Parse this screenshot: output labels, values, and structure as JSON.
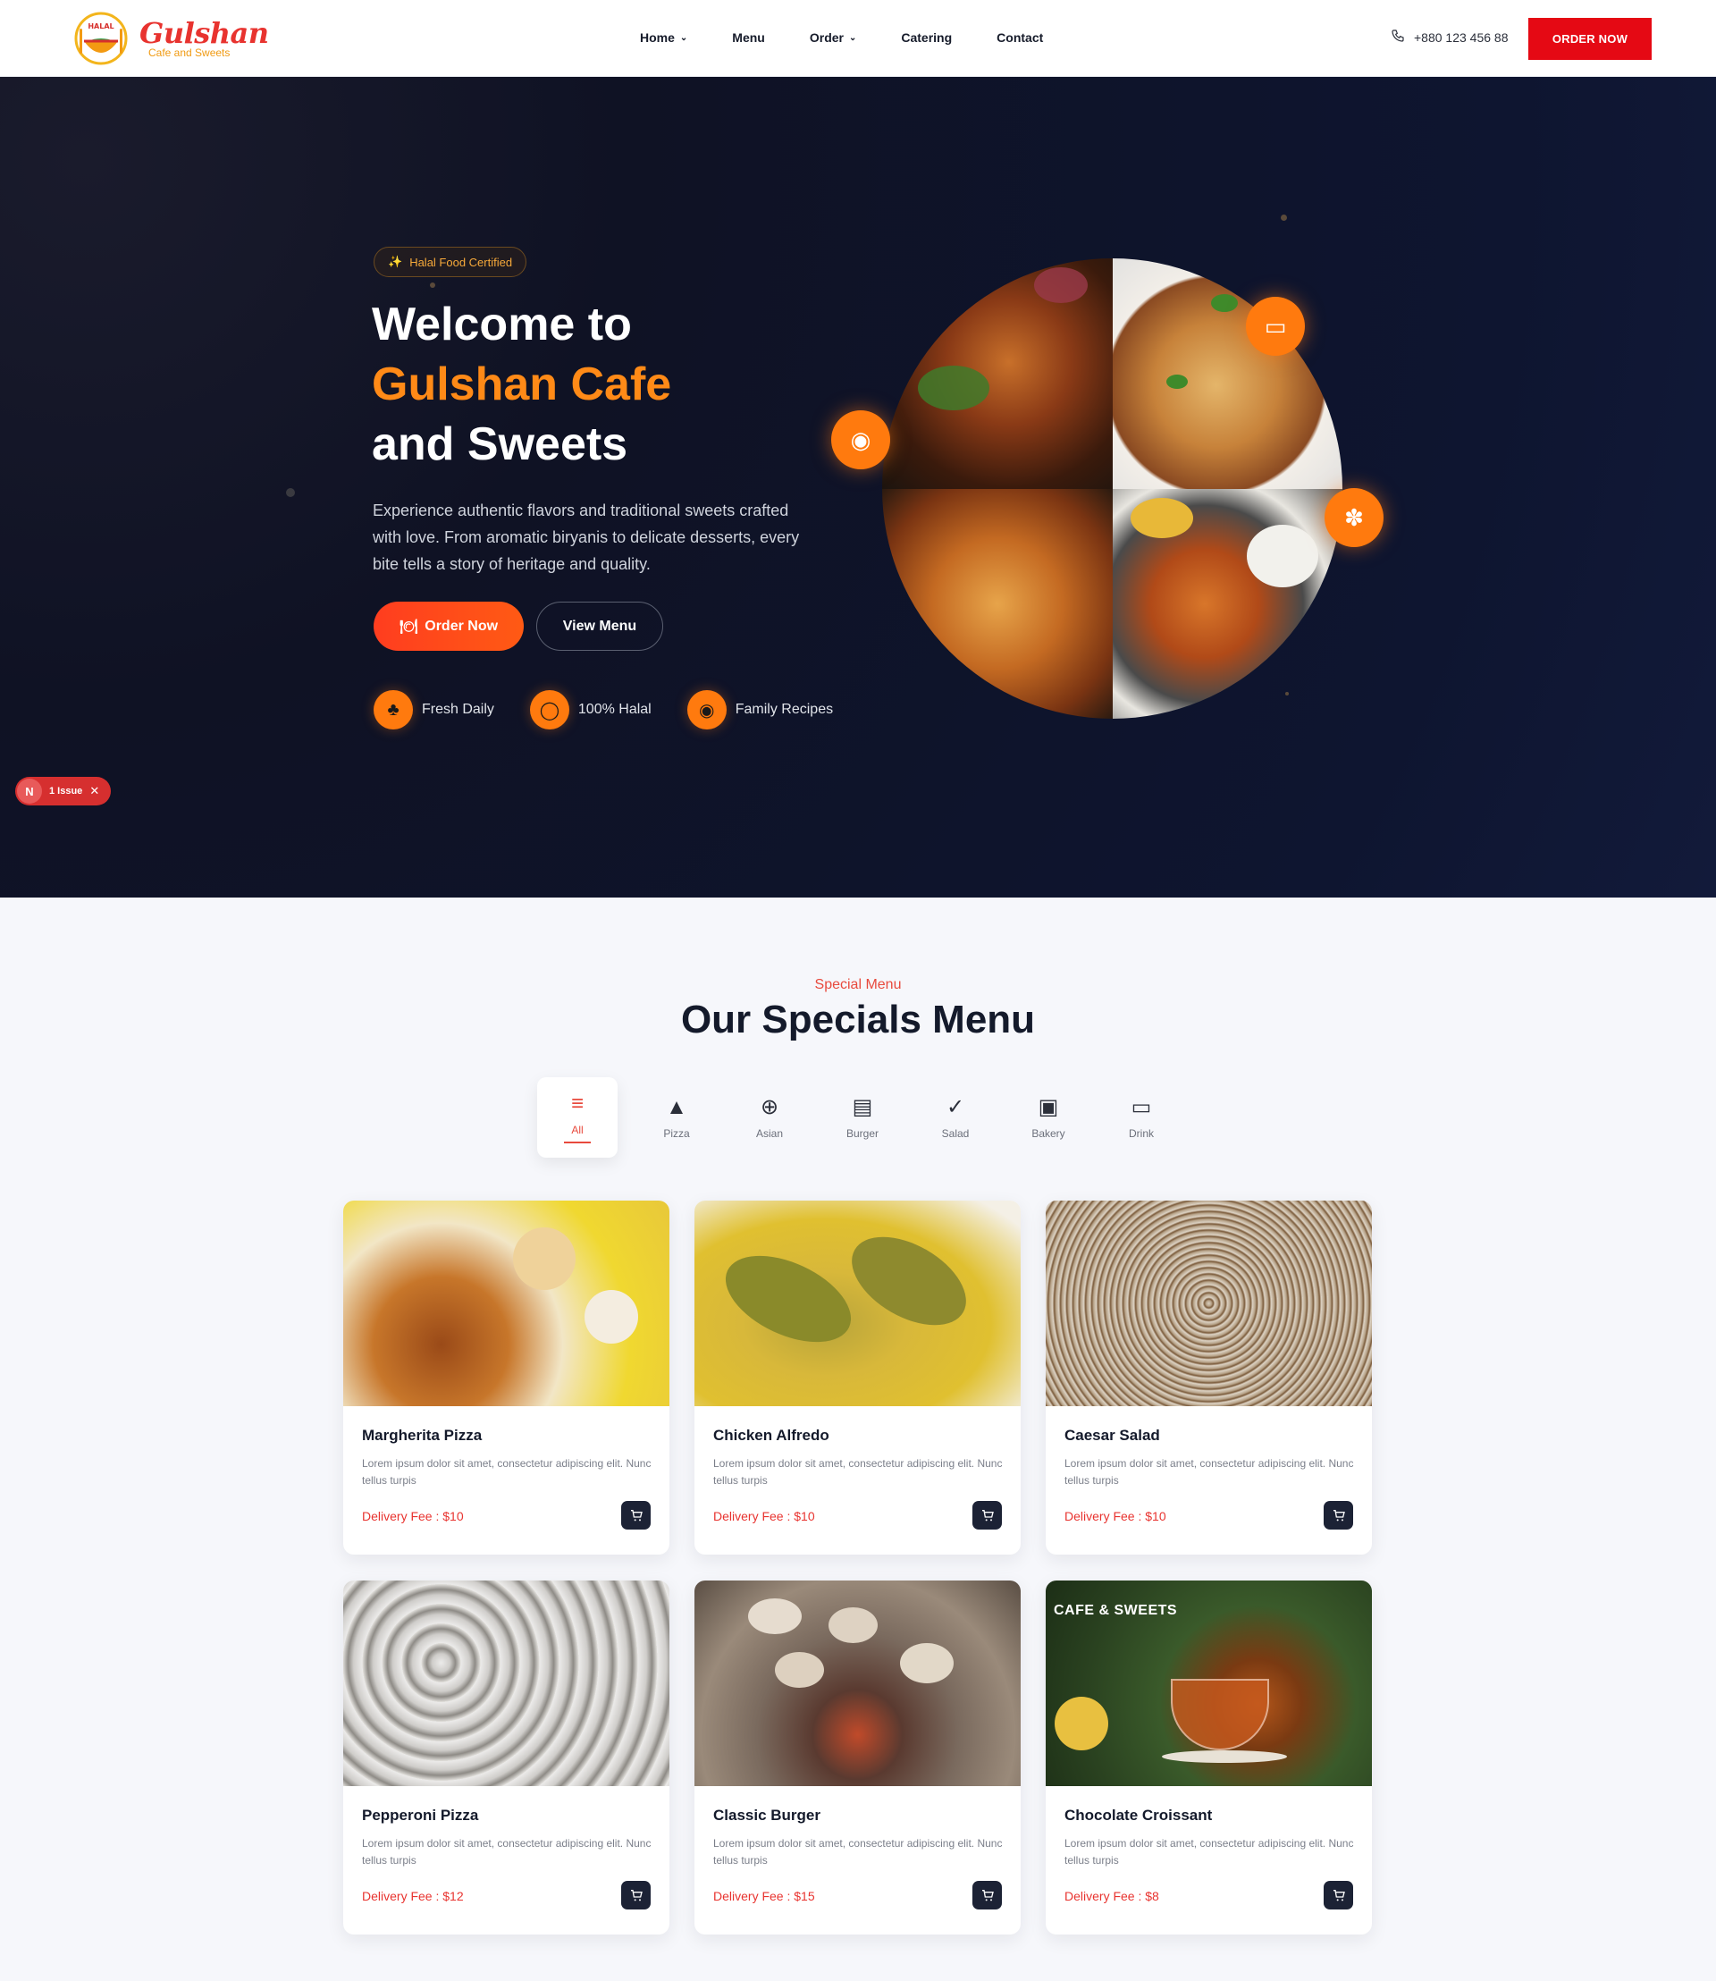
{
  "header": {
    "brand_name": "Gulshan",
    "brand_sub": "Cafe and Sweets",
    "halal_mark": "HALAL",
    "nav": [
      {
        "label": "Home",
        "has_dropdown": true
      },
      {
        "label": "Menu",
        "has_dropdown": false
      },
      {
        "label": "Order",
        "has_dropdown": true
      },
      {
        "label": "Catering",
        "has_dropdown": false
      },
      {
        "label": "Contact",
        "has_dropdown": false
      }
    ],
    "phone": "+880 123 456 88",
    "cta": "ORDER NOW"
  },
  "hero": {
    "badge": "Halal Food Certified",
    "title_line1": "Welcome to",
    "title_accent": "Gulshan Cafe",
    "title_line3": "and Sweets",
    "description": "Experience authentic flavors and traditional sweets crafted with love. From aromatic biryanis to delicate desserts, every bite tells a story of heritage and quality.",
    "primary_button": "Order Now",
    "secondary_button": "View Menu",
    "features": [
      {
        "label": "Fresh Daily",
        "icon": "clover-icon"
      },
      {
        "label": "100% Halal",
        "icon": "medal-icon"
      },
      {
        "label": "Family Recipes",
        "icon": "plate-icon"
      }
    ]
  },
  "issue_pill": {
    "letter": "N",
    "label": "1 Issue"
  },
  "specials": {
    "eyebrow": "Special Menu",
    "title": "Our Specials Menu",
    "categories": [
      {
        "label": "All",
        "icon": "list-icon",
        "active": true
      },
      {
        "label": "Pizza",
        "icon": "pizza-icon",
        "active": false
      },
      {
        "label": "Asian",
        "icon": "asian-icon",
        "active": false
      },
      {
        "label": "Burger",
        "icon": "burger-icon",
        "active": false
      },
      {
        "label": "Salad",
        "icon": "salad-icon",
        "active": false
      },
      {
        "label": "Bakery",
        "icon": "bakery-icon",
        "active": false
      },
      {
        "label": "Drink",
        "icon": "drink-icon",
        "active": false
      }
    ],
    "items": [
      {
        "name": "Margherita Pizza",
        "desc": "Lorem ipsum dolor sit amet, consectetur adipiscing elit. Nunc tellus turpis",
        "fee": "Delivery Fee : $10"
      },
      {
        "name": "Chicken Alfredo",
        "desc": "Lorem ipsum dolor sit amet, consectetur adipiscing elit. Nunc tellus turpis",
        "fee": "Delivery Fee : $10"
      },
      {
        "name": "Caesar Salad",
        "desc": "Lorem ipsum dolor sit amet, consectetur adipiscing elit. Nunc tellus turpis",
        "fee": "Delivery Fee : $10"
      },
      {
        "name": "Pepperoni Pizza",
        "desc": "Lorem ipsum dolor sit amet, consectetur adipiscing elit. Nunc tellus turpis",
        "fee": "Delivery Fee : $12"
      },
      {
        "name": "Classic Burger",
        "desc": "Lorem ipsum dolor sit amet, consectetur adipiscing elit. Nunc tellus turpis",
        "fee": "Delivery Fee : $15"
      },
      {
        "name": "Chocolate Croissant",
        "desc": "Lorem ipsum dolor sit amet, consectetur adipiscing elit. Nunc tellus turpis",
        "fee": "Delivery Fee : $8"
      }
    ],
    "tea_image_caption": "CAFE & SWEETS"
  },
  "colors": {
    "brand_red": "#e50914",
    "accent_orange": "#ff7a0e",
    "hero_bg": "#0f1224",
    "card_dark": "#1c2235"
  }
}
